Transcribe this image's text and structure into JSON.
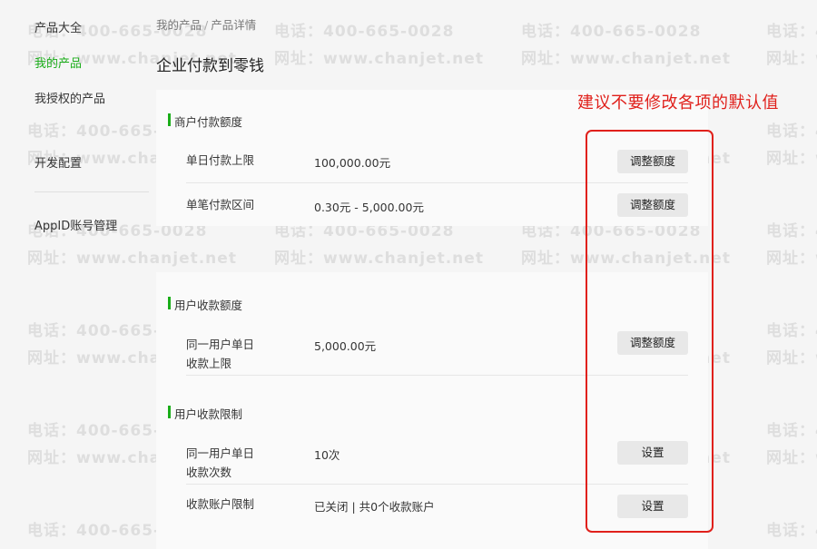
{
  "sidebar": {
    "items": [
      {
        "label": "产品大全"
      },
      {
        "label": "我的产品"
      },
      {
        "label": "我授权的产品"
      },
      {
        "label": "开发配置"
      },
      {
        "label": "AppID账号管理"
      }
    ]
  },
  "breadcrumb": {
    "items": [
      "我的产品",
      "产品详情"
    ],
    "separator": "/"
  },
  "page_title": "企业付款到零钱",
  "sections": [
    {
      "header": "商户付款额度",
      "rows": [
        {
          "label": "单日付款上限",
          "value": "100,000.00元",
          "button": "调整额度"
        },
        {
          "label": "单笔付款区间",
          "value": "0.30元 - 5,000.00元",
          "button": "调整额度"
        }
      ]
    },
    {
      "header": "用户收款额度",
      "rows": [
        {
          "label": "同一用户单日收款上限",
          "value": "5,000.00元",
          "button": "调整额度"
        }
      ]
    },
    {
      "header": "用户收款限制",
      "rows": [
        {
          "label": "同一用户单日收款次数",
          "value": "10次",
          "button": "设置"
        },
        {
          "label": "收款账户限制",
          "value": "已关闭 | 共0个收款账户",
          "button": "设置"
        }
      ]
    }
  ],
  "annotation": {
    "text": "建议不要修改各项的默认值",
    "color": "#e0201b"
  },
  "watermark": {
    "phone": "电话：400-665-0028",
    "site": "网址：www.chanjet.net"
  },
  "colors": {
    "accent": "#1aad19",
    "annotation": "#e0201b"
  }
}
